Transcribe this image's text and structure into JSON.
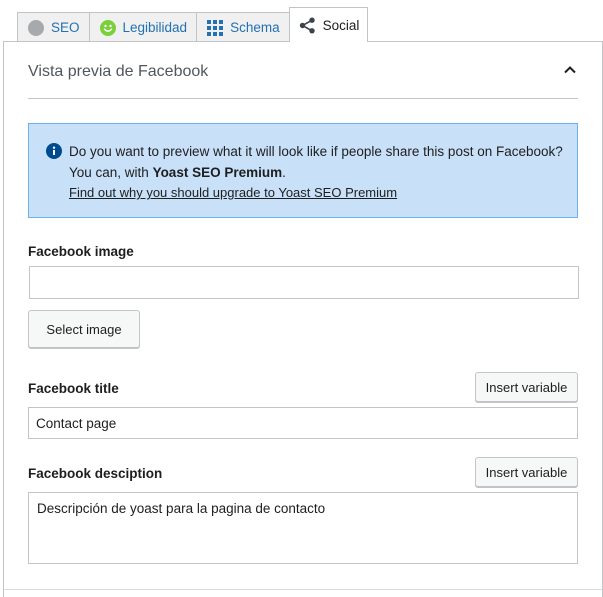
{
  "tabs": [
    {
      "label": "SEO",
      "icon": "seo-score-dot-icon"
    },
    {
      "label": "Legibilidad",
      "icon": "readability-smiley-icon"
    },
    {
      "label": "Schema",
      "icon": "schema-grid-icon"
    },
    {
      "label": "Social",
      "icon": "share-icon",
      "active": true
    }
  ],
  "colors": {
    "accent": "#2271b1",
    "alert_bg": "#c8e1f9",
    "alert_border": "#70b0ec",
    "good": "#7ad03a"
  },
  "section": {
    "title": "Vista previa de Facebook",
    "collapse_icon": "chevron-up-icon"
  },
  "alert": {
    "text_before": "Do you want to preview what it will look like if people share this post on Facebook? You can, with ",
    "strong": "Yoast SEO Premium",
    "text_after": ".",
    "link": "Find out why you should upgrade to Yoast SEO Premium"
  },
  "image_field": {
    "label": "Facebook image",
    "value": "",
    "button": "Select image"
  },
  "title_field": {
    "label": "Facebook title",
    "value": "Contact page",
    "button": "Insert variable"
  },
  "desc_field": {
    "label": "Facebook desciption",
    "value": "Descripción de yoast para la pagina de contacto",
    "button": "Insert variable"
  }
}
